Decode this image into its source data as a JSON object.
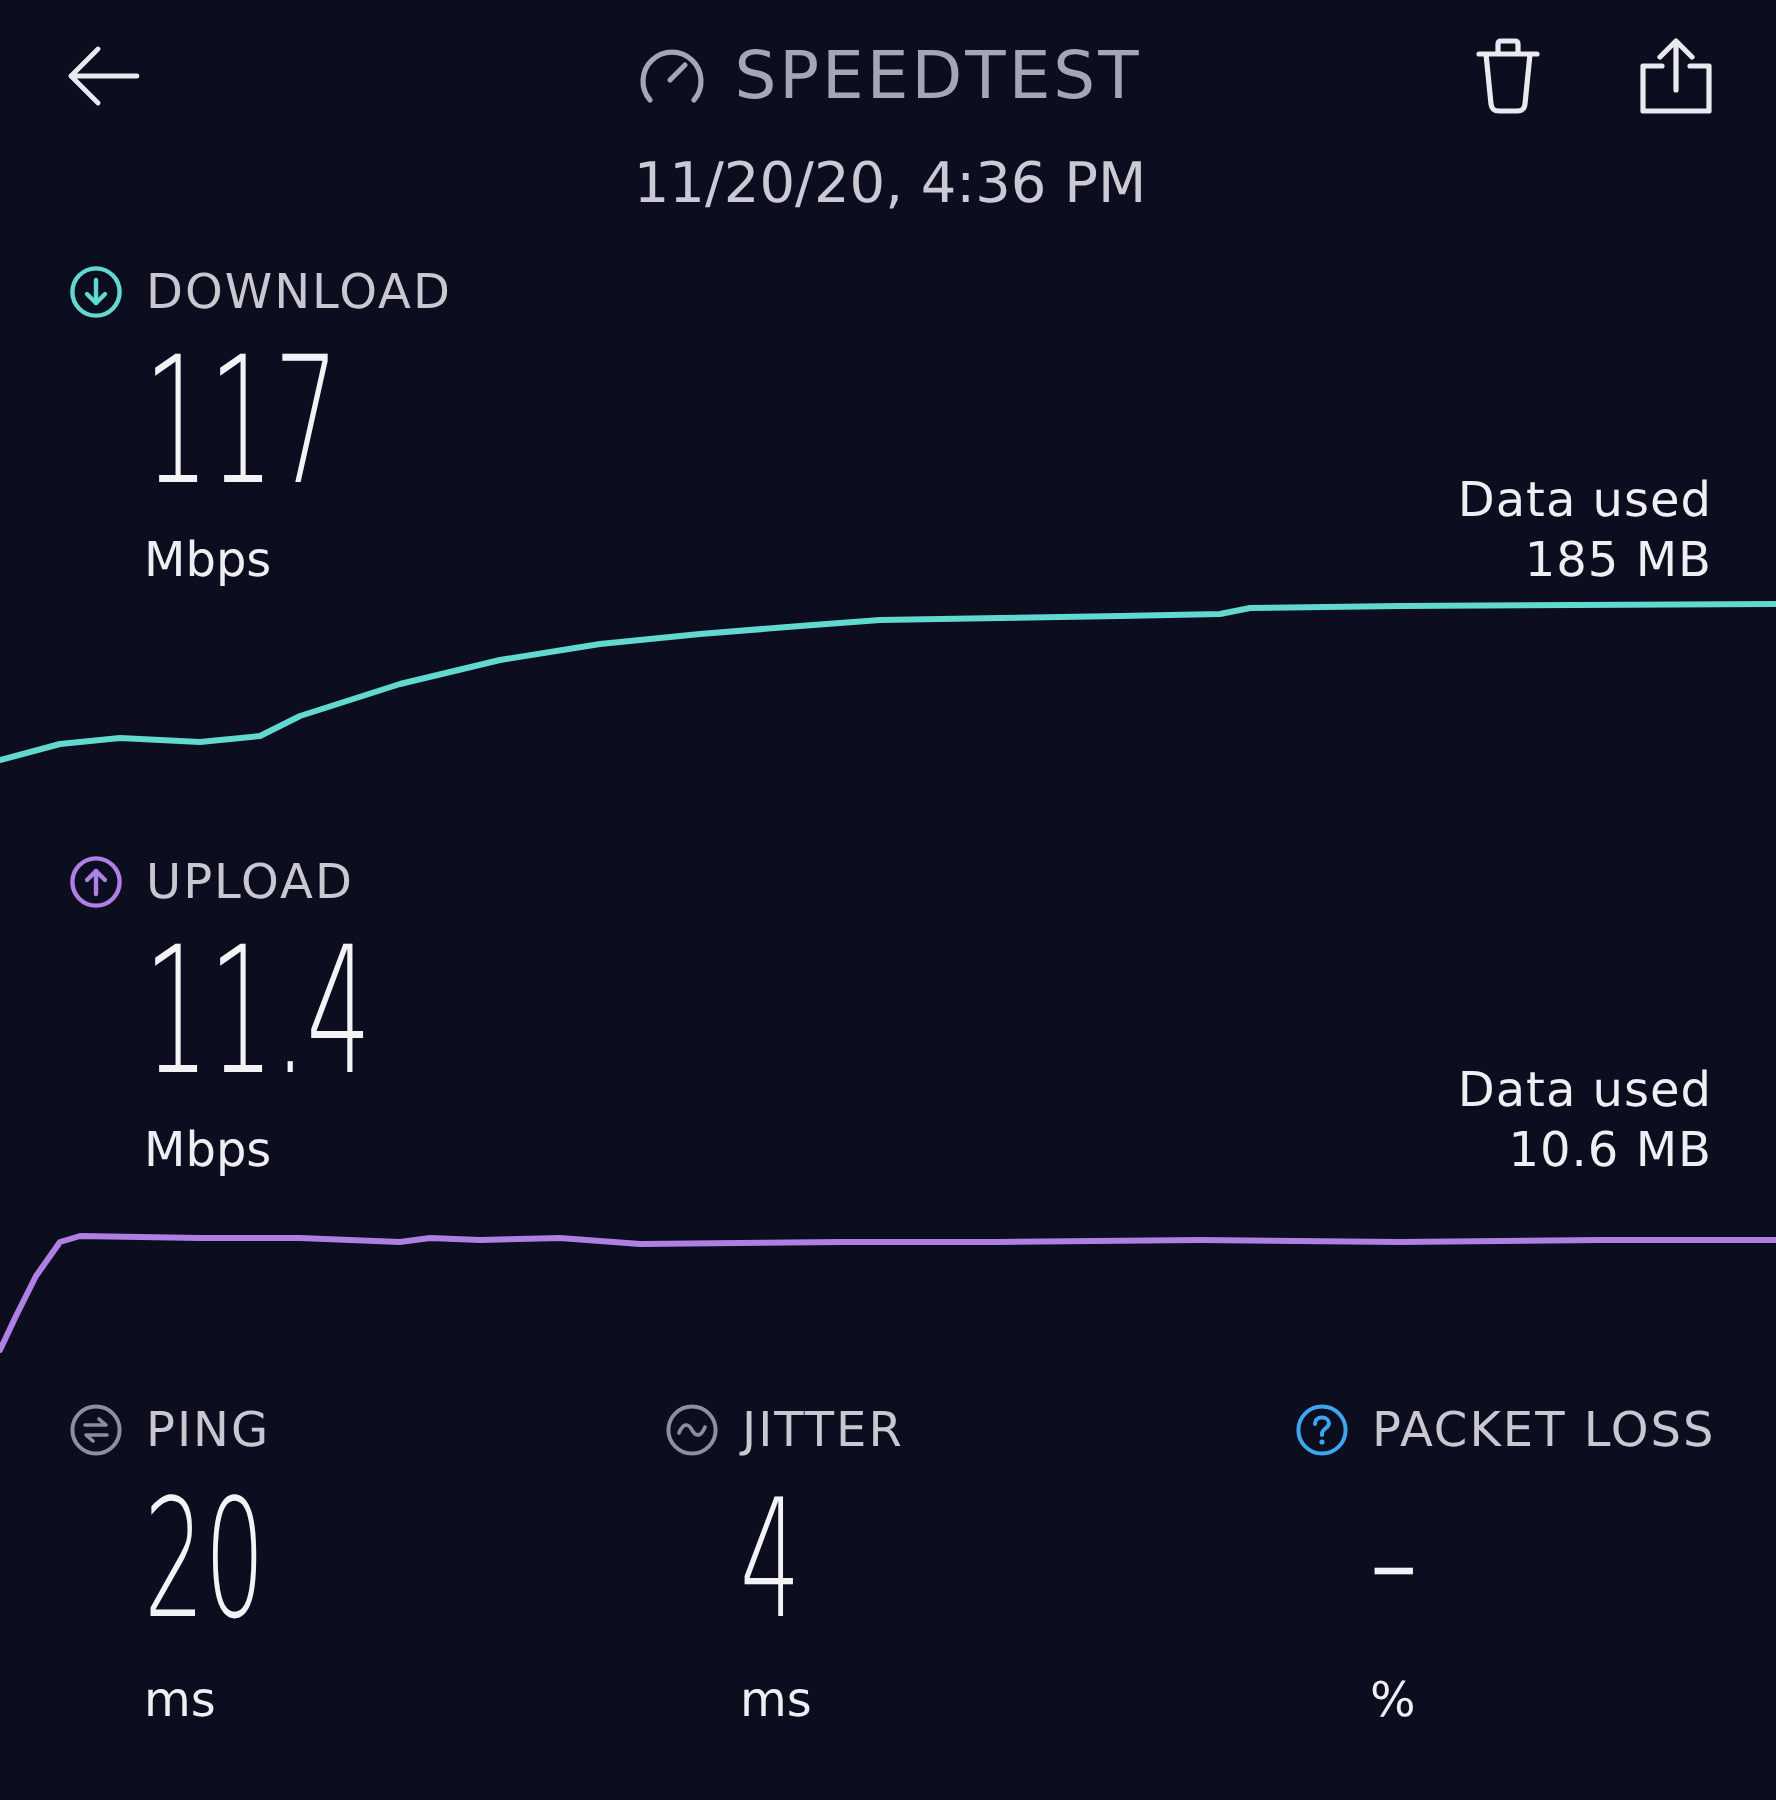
{
  "header": {
    "title": "SPEEDTEST",
    "date": "11/20/20, 4:36 PM"
  },
  "results": [
    {
      "kind": "download",
      "label": "DOWNLOAD",
      "value": "117",
      "unit": "Mbps",
      "data_used_label": "Data used",
      "data_used": "185 MB",
      "color": "#62d9d0"
    },
    {
      "kind": "upload",
      "label": "UPLOAD",
      "value": "11.4",
      "unit": "Mbps",
      "data_used_label": "Data used",
      "data_used": "10.6 MB",
      "color": "#b07fe3"
    }
  ],
  "metrics": [
    {
      "kind": "ping",
      "label": "PING",
      "value": "20",
      "unit": "ms",
      "color": "#8d8f9c"
    },
    {
      "kind": "jitter",
      "label": "JITTER",
      "value": "4",
      "unit": "ms",
      "color": "#8d8f9c"
    },
    {
      "kind": "packet_loss",
      "label": "PACKET LOSS",
      "value": "–",
      "unit": "%",
      "color": "#3da6ee"
    }
  ]
}
